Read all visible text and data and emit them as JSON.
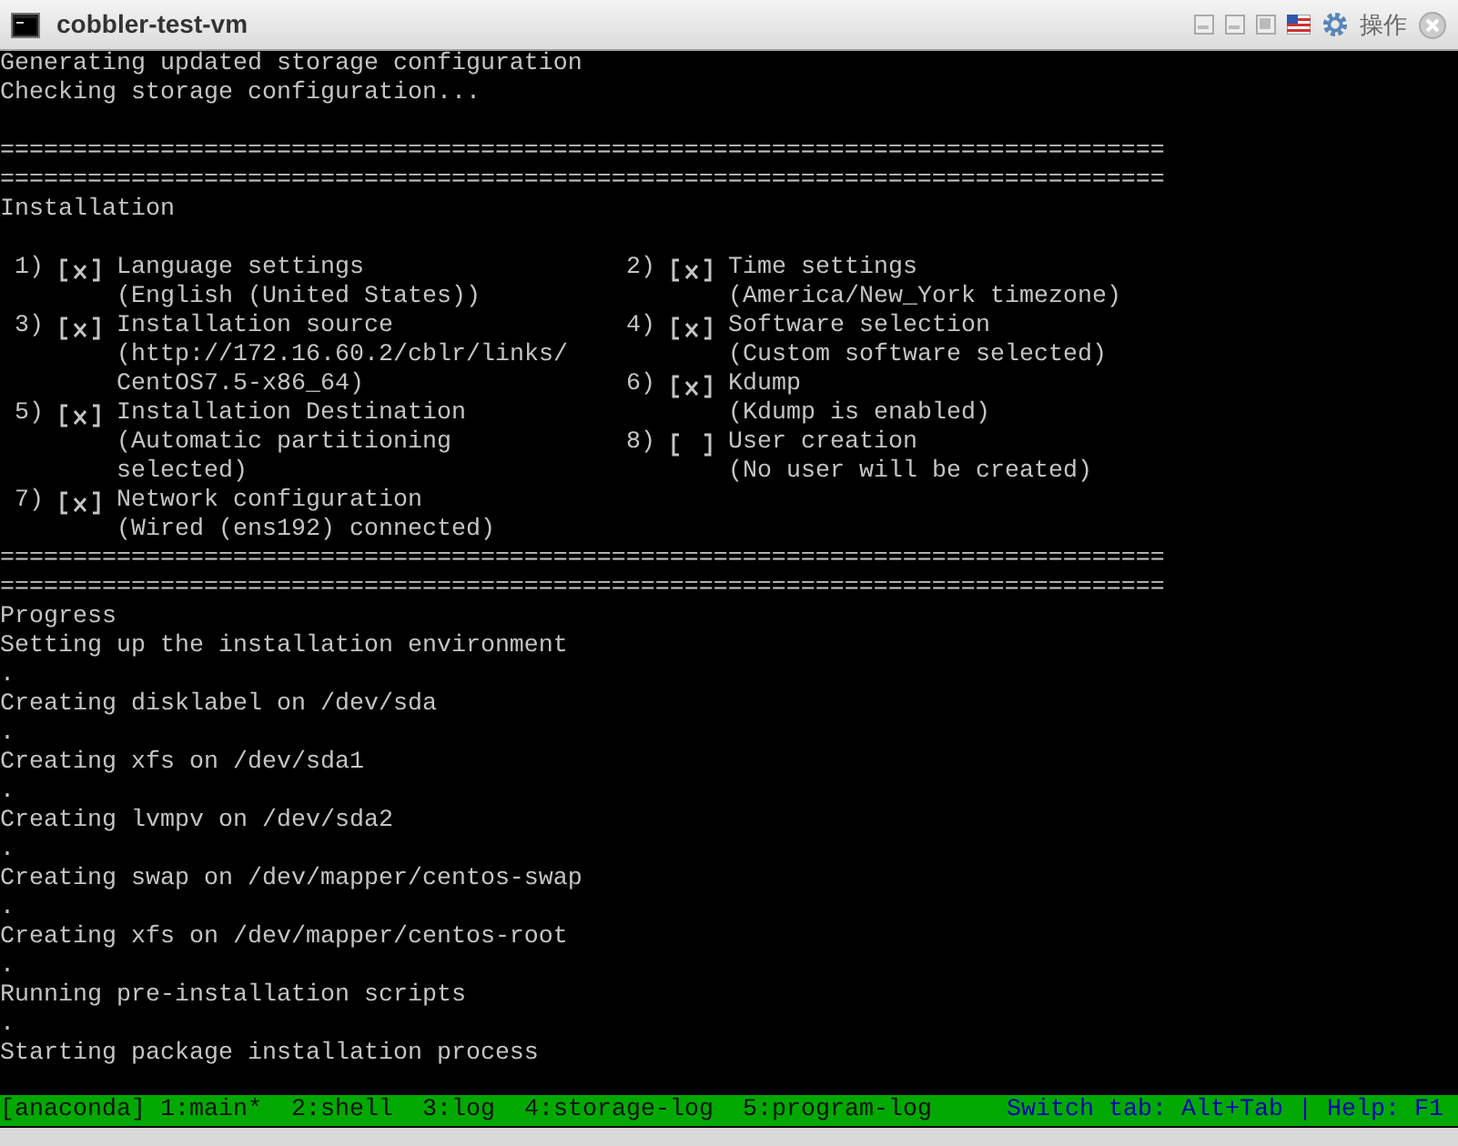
{
  "window": {
    "title": "cobbler-test-vm",
    "menu_label": "操作"
  },
  "console": {
    "header_lines": [
      "Generating updated storage configuration",
      "Checking storage configuration..."
    ],
    "rules_top": [
      "================================================================================",
      "================================================================================"
    ],
    "heading": "Installation",
    "spokes": {
      "left": [
        {
          "number": "1)",
          "checked": true,
          "title": "Language settings",
          "details": [
            "(English (United States))"
          ]
        },
        {
          "number": "3)",
          "checked": true,
          "title": "Installation source",
          "details": [
            "(http://172.16.60.2/cblr/links/",
            "CentOS7.5-x86_64)"
          ]
        },
        {
          "number": "5)",
          "checked": true,
          "title": "Installation Destination",
          "details": [
            "(Automatic partitioning",
            "selected)"
          ]
        },
        {
          "number": "7)",
          "checked": true,
          "title": "Network configuration",
          "details": [
            "(Wired (ens192) connected)"
          ]
        }
      ],
      "right": [
        {
          "number": "2)",
          "checked": true,
          "title": "Time settings",
          "details": [
            "(America/New_York timezone)"
          ]
        },
        {
          "number": "4)",
          "checked": true,
          "title": "Software selection",
          "details": [
            "(Custom software selected)"
          ]
        },
        {
          "number": "6)",
          "checked": true,
          "title": "Kdump",
          "details": [
            "(Kdump is enabled)"
          ]
        },
        {
          "number": "8)",
          "checked": false,
          "title": "User creation",
          "details": [
            "(No user will be created)"
          ]
        }
      ]
    },
    "rules_bottom": [
      "================================================================================",
      "================================================================================"
    ],
    "progress_heading": "Progress",
    "progress_lines": [
      "Setting up the installation environment",
      ".",
      "Creating disklabel on /dev/sda",
      ".",
      "Creating xfs on /dev/sda1",
      ".",
      "Creating lvmpv on /dev/sda2",
      ".",
      "Creating swap on /dev/mapper/centos-swap",
      ".",
      "Creating xfs on /dev/mapper/centos-root",
      ".",
      "Running pre-installation scripts",
      ".",
      "Starting package installation process"
    ]
  },
  "status_bar": {
    "app": "[anaconda]",
    "tabs": [
      "1:main*",
      "2:shell",
      "3:log",
      "4:storage-log",
      "5:program-log"
    ],
    "hint": "Switch tab: Alt+Tab | Help: F1"
  }
}
